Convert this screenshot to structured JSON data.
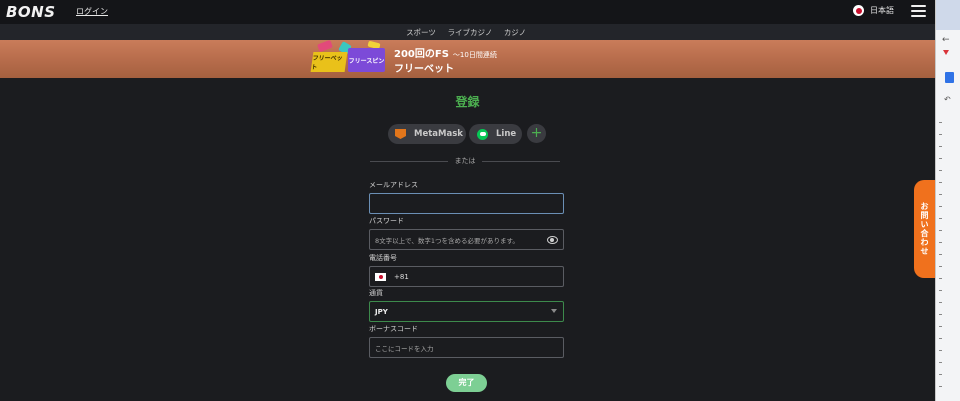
{
  "header": {
    "logo": "BONS",
    "login": "ログイン",
    "language": "日本語"
  },
  "tabs": [
    {
      "label": "スポーツ"
    },
    {
      "label": "ライブカジノ"
    },
    {
      "label": "カジノ"
    }
  ],
  "banner": {
    "tag_a": "フリーベット",
    "tag_b": "フリースピン",
    "title": "200回のFS",
    "subtitle": "〜10日間連続",
    "line2": "フリーベット"
  },
  "form": {
    "title": "登録",
    "metamask": "MetaMask",
    "line": "Line",
    "plus": "+",
    "or": "または",
    "email_label": "メールアドレス",
    "email_value": "",
    "password_label": "パスワード",
    "password_placeholder": "8文字以上で、数字1つを含める必要があります。",
    "phone_label": "電話番号",
    "phone_code": "+81",
    "currency_label": "通貨",
    "currency_value": "JPY",
    "bonus_label": "ボーナスコード",
    "bonus_placeholder": "ここにコードを入力",
    "submit": "完了"
  },
  "contact": "お問い合わせ",
  "colors": {
    "accent_green": "#4caf50",
    "banner": "#b86d4c",
    "contact": "#f0711d"
  }
}
